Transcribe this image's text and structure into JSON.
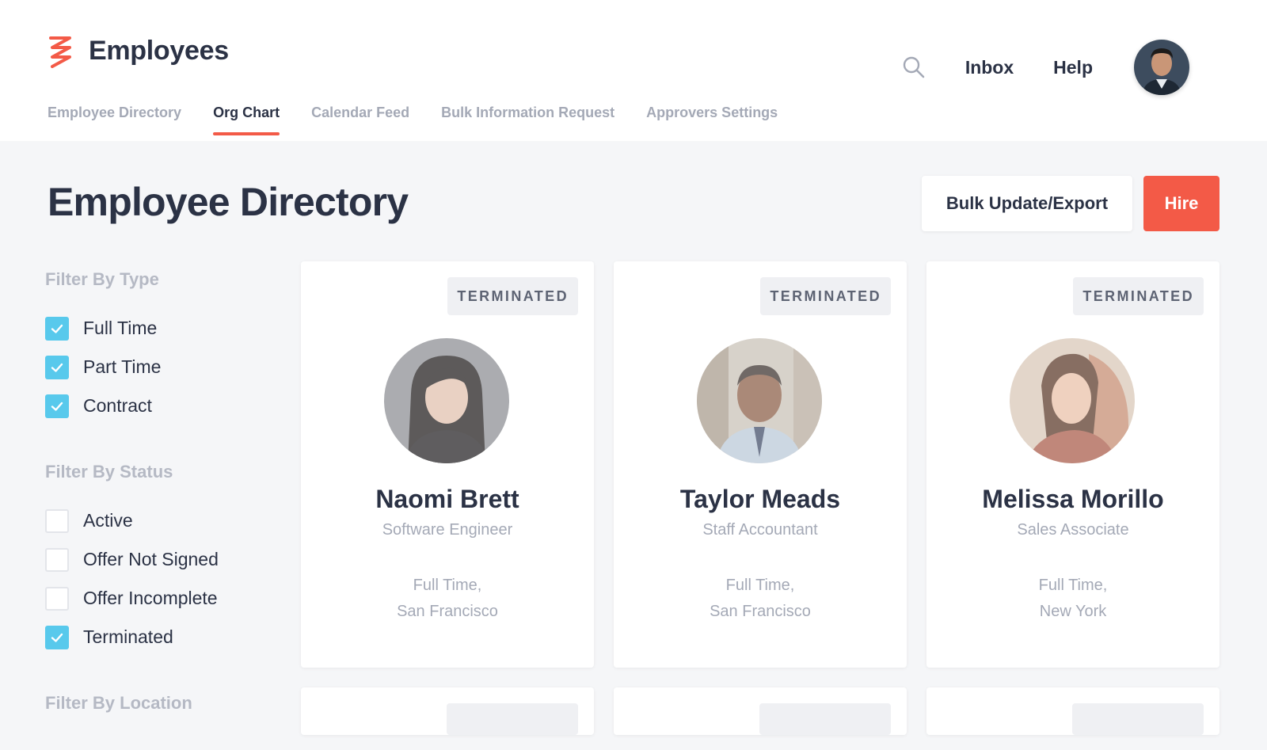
{
  "app": {
    "title": "Employees",
    "brand_color": "#f35a47"
  },
  "topnav": {
    "inbox": "Inbox",
    "help": "Help"
  },
  "tabs": [
    {
      "label": "Employee Directory",
      "active": false
    },
    {
      "label": "Org Chart",
      "active": true
    },
    {
      "label": "Calendar Feed",
      "active": false
    },
    {
      "label": "Bulk Information Request",
      "active": false
    },
    {
      "label": "Approvers Settings",
      "active": false
    }
  ],
  "page": {
    "title": "Employee Directory"
  },
  "actions": {
    "bulk": "Bulk Update/Export",
    "hire": "Hire"
  },
  "filters": {
    "type": {
      "title": "Filter By Type",
      "options": [
        {
          "label": "Full Time",
          "checked": true
        },
        {
          "label": "Part Time",
          "checked": true
        },
        {
          "label": "Contract",
          "checked": true
        }
      ]
    },
    "status": {
      "title": "Filter By Status",
      "options": [
        {
          "label": "Active",
          "checked": false
        },
        {
          "label": "Offer Not Signed",
          "checked": false
        },
        {
          "label": "Offer Incomplete",
          "checked": false
        },
        {
          "label": "Terminated",
          "checked": true
        }
      ]
    },
    "location": {
      "title": "Filter By Location"
    }
  },
  "employees": [
    {
      "status": "TERMINATED",
      "name": "Naomi Brett",
      "title": "Software Engineer",
      "type": "Full Time,",
      "location": "San Francisco"
    },
    {
      "status": "TERMINATED",
      "name": "Taylor Meads",
      "title": "Staff Accountant",
      "type": "Full Time,",
      "location": "San Francisco"
    },
    {
      "status": "TERMINATED",
      "name": "Melissa Morillo",
      "title": "Sales Associate",
      "type": "Full Time,",
      "location": "New York"
    }
  ],
  "colors": {
    "accent": "#f35a47",
    "checkbox": "#58c9ec",
    "text": "#2b3245",
    "muted": "#a4a9b6"
  }
}
